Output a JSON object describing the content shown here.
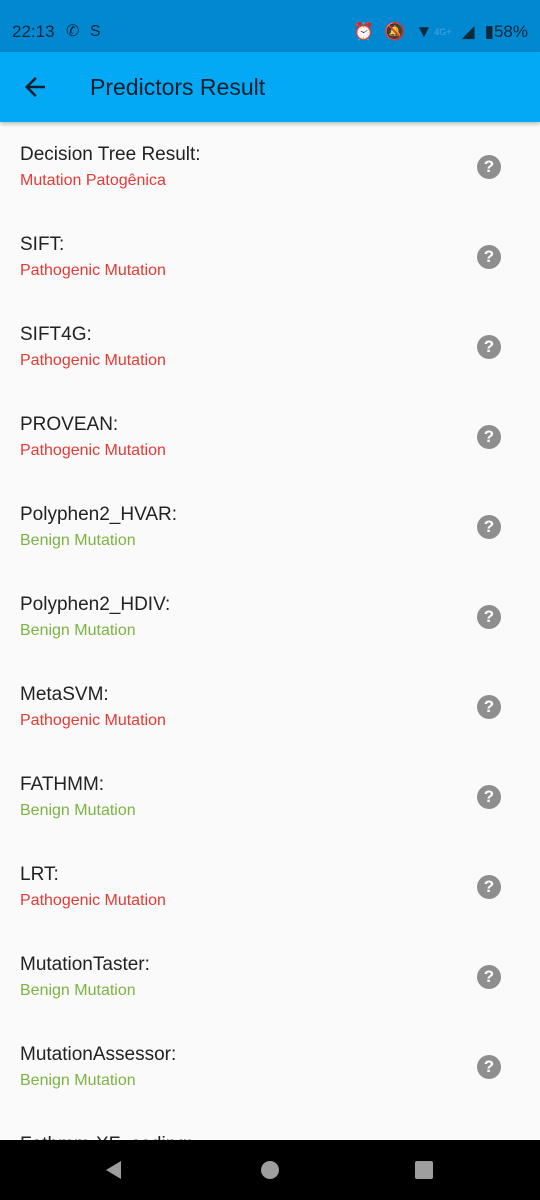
{
  "status_bar": {
    "time": "22:13",
    "battery": "58%",
    "network": "4G+"
  },
  "app_bar": {
    "title": "Predictors Result"
  },
  "colors": {
    "pathogenic": "#e53935",
    "benign": "#7cb342",
    "app_bar": "#03a9f4",
    "status_bar": "#0288d1"
  },
  "items": [
    {
      "label": "Decision Tree Result:",
      "value": "Mutation Patogênica",
      "type": "pathogenic"
    },
    {
      "label": "SIFT:",
      "value": "Pathogenic Mutation",
      "type": "pathogenic"
    },
    {
      "label": "SIFT4G:",
      "value": "Pathogenic Mutation",
      "type": "pathogenic"
    },
    {
      "label": "PROVEAN:",
      "value": "Pathogenic Mutation",
      "type": "pathogenic"
    },
    {
      "label": "Polyphen2_HVAR:",
      "value": "Benign Mutation",
      "type": "benign"
    },
    {
      "label": "Polyphen2_HDIV:",
      "value": "Benign Mutation",
      "type": "benign"
    },
    {
      "label": "MetaSVM:",
      "value": "Pathogenic Mutation",
      "type": "pathogenic"
    },
    {
      "label": "FATHMM:",
      "value": "Benign Mutation",
      "type": "benign"
    },
    {
      "label": "LRT:",
      "value": "Pathogenic Mutation",
      "type": "pathogenic"
    },
    {
      "label": "MutationTaster:",
      "value": "Benign Mutation",
      "type": "benign"
    },
    {
      "label": "MutationAssessor:",
      "value": "Benign Mutation",
      "type": "benign"
    },
    {
      "label": "Fathmm-XF_coding:",
      "value": "",
      "type": "benign"
    }
  ]
}
